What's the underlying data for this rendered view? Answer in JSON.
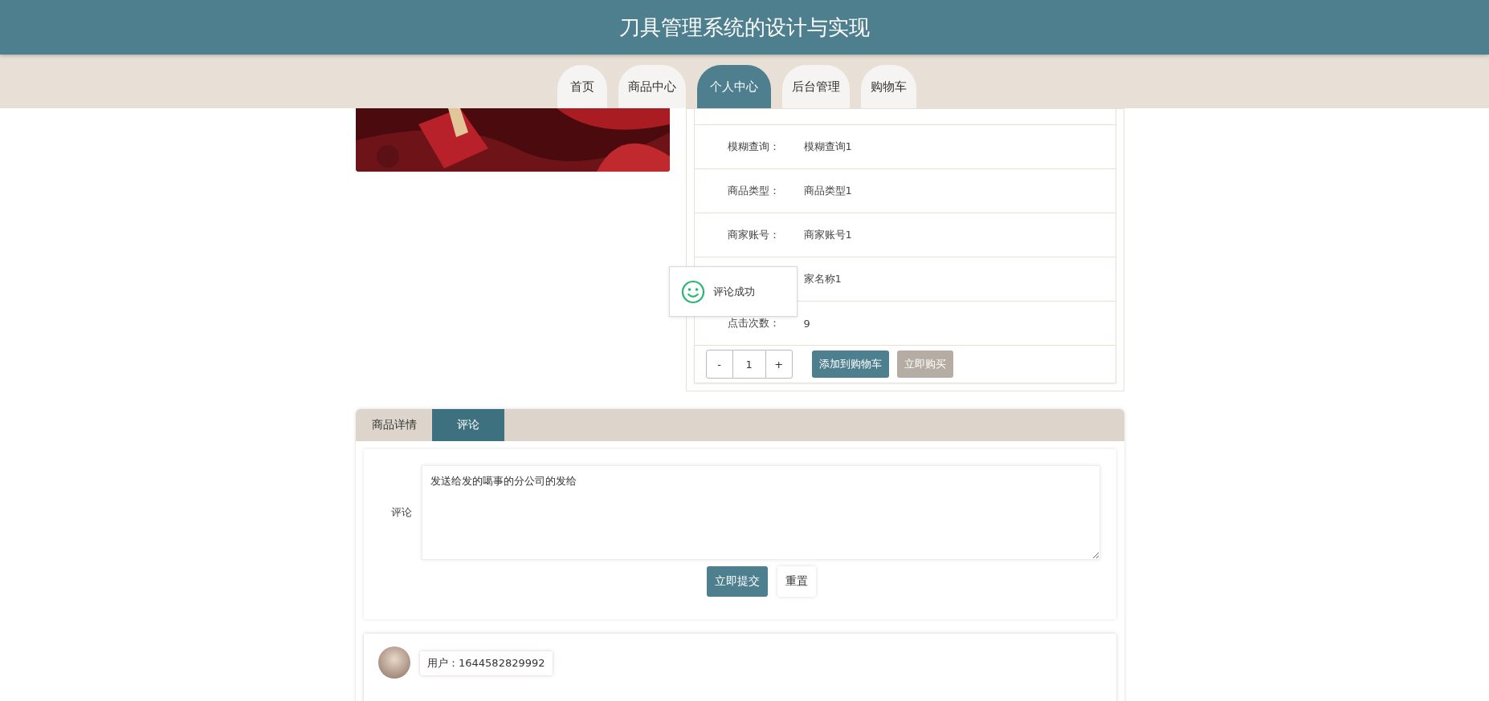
{
  "header": {
    "title": "刀具管理系统的设计与实现"
  },
  "nav": [
    {
      "label": "首页",
      "selected": false
    },
    {
      "label": "商品中心",
      "selected": false
    },
    {
      "label": "个人中心",
      "selected": true
    },
    {
      "label": "后台管理",
      "selected": false
    },
    {
      "label": "购物车",
      "selected": false
    }
  ],
  "product": {
    "fields": [
      {
        "label": "模糊查询：",
        "value": "模糊查询1"
      },
      {
        "label": "商品类型：",
        "value": "商品类型1"
      },
      {
        "label": "商家账号：",
        "value": "商家账号1"
      },
      {
        "value": "家名称1"
      },
      {
        "label": "点击次数：",
        "value": "9"
      }
    ],
    "quantity": {
      "minus": "-",
      "value": "1",
      "plus": "+"
    },
    "buttons": [
      {
        "label": "添加到购物车",
        "kind": "primary"
      },
      {
        "label": "立即购买",
        "kind": "muted"
      }
    ]
  },
  "toast": {
    "message": "评论成功"
  },
  "detail_tabs": [
    {
      "label": "商品详情",
      "selected": false
    },
    {
      "label": "评论",
      "selected": true
    }
  ],
  "comment_form": {
    "label": "评论",
    "value": "发送给发的噶事的分公司的发给",
    "buttons": [
      {
        "label": "立即提交",
        "kind": "primary"
      },
      {
        "label": "重置",
        "kind": "plain"
      }
    ]
  },
  "comments": [
    {
      "user": "用户：1644582829992"
    }
  ]
}
